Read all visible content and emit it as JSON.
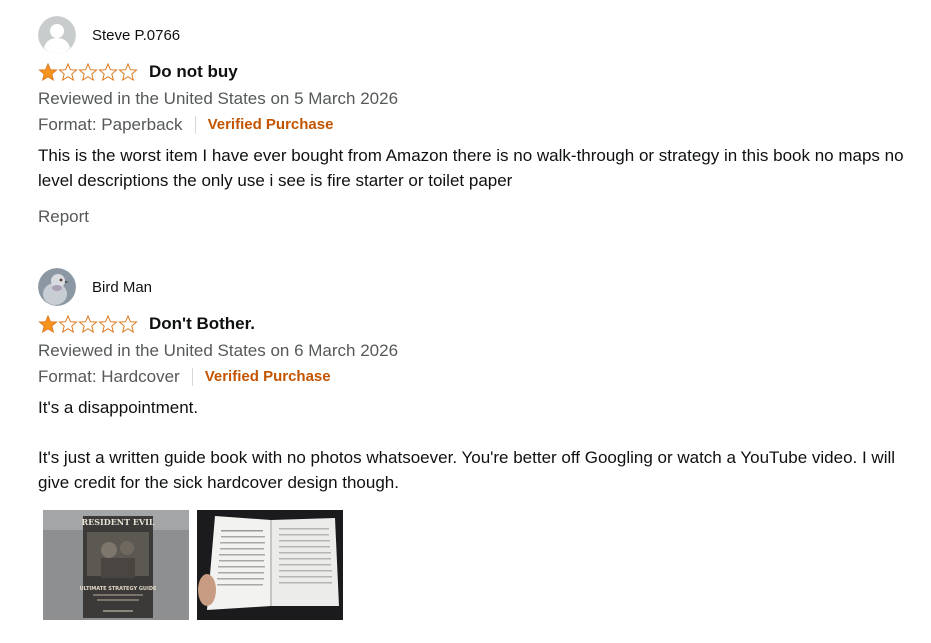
{
  "reviews": [
    {
      "profile_name": "Steve P.0766",
      "rating": "1.0 out of 5 stars",
      "title": "Do not buy",
      "date": "Reviewed in the United States on 5 March 2026",
      "format": "Format: Paperback",
      "verified": "Verified Purchase",
      "body": [
        "This is the worst item I have ever bought from Amazon there is no walk-through or strategy in this book no maps no level descriptions the only use i see is fire starter or toilet paper"
      ],
      "report": "Report"
    },
    {
      "profile_name": "Bird Man",
      "rating": "1.0 out of 5 stars",
      "title": "Don't Bother.",
      "date": "Reviewed in the United States on 6 March 2026",
      "format": "Format: Hardcover",
      "verified": "Verified Purchase",
      "body": [
        "It's a disappointment.",
        "It's just a written guide book with no photos whatsoever. You're better off Googling or watch a YouTube video. I will give credit for the sick hardcover design though."
      ],
      "images": [
        {
          "cover_title": "RESIDENT EVIL",
          "cover_subtitle": "ULTIMATE STRATEGY GUIDE"
        },
        {}
      ]
    }
  ],
  "colors": {
    "star_fill": "#f7941d",
    "star_outline": "#de7921",
    "verified": "#c45500",
    "muted_text": "#565959"
  }
}
